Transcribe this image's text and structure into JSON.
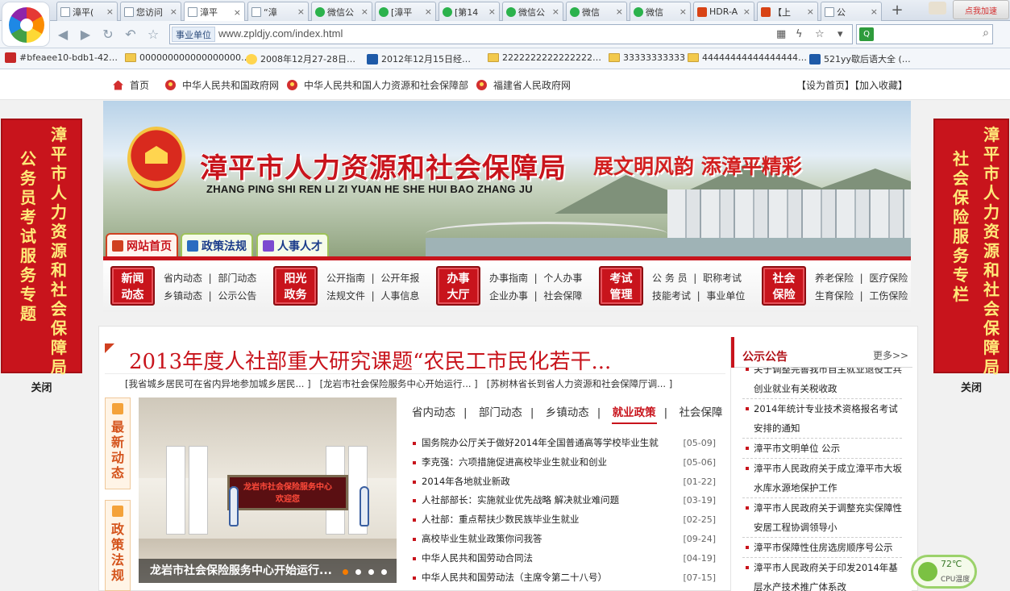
{
  "browser": {
    "tabs": [
      {
        "label": "漳平(",
        "icon": "page"
      },
      {
        "label": "您访问",
        "icon": "page"
      },
      {
        "label": "漳平",
        "icon": "page",
        "active": true
      },
      {
        "label": "“漳",
        "icon": "page"
      },
      {
        "label": "微信公",
        "icon": "wechat"
      },
      {
        "label": "[漳平",
        "icon": "wechat"
      },
      {
        "label": "[第14",
        "icon": "wechat"
      },
      {
        "label": "微信公",
        "icon": "wechat"
      },
      {
        "label": "微信",
        "icon": "wechat"
      },
      {
        "label": "微信",
        "icon": "wechat"
      },
      {
        "label": "HDR-A",
        "icon": "taobao"
      },
      {
        "label": "【上",
        "icon": "taobao"
      },
      {
        "label": "公",
        "icon": "page"
      }
    ],
    "new_tab": "+",
    "speedup_label": "点我加速",
    "site_tag": "事业单位",
    "url": "www.zpldjy.com/index.html",
    "bookmarks": [
      {
        "label": "#bfeaee10-bdb1-42…",
        "icon": "site-red"
      },
      {
        "label": "000000000000000000…",
        "icon": "folder"
      },
      {
        "label": "2008年12月27-28日…",
        "icon": "site-yellow"
      },
      {
        "label": "2012年12月15日经…",
        "icon": "site-blue"
      },
      {
        "label": "2222222222222222…",
        "icon": "folder"
      },
      {
        "label": "33333333333",
        "icon": "folder"
      },
      {
        "label": "44444444444444444…",
        "icon": "folder"
      },
      {
        "label": "521yy歇后语大全 (…",
        "icon": "site-blue"
      }
    ]
  },
  "site": {
    "topnav": {
      "home": "首页",
      "links": [
        "中华人民共和国政府网",
        "中华人民共和国人力资源和社会保障部",
        "福建省人民政府网"
      ],
      "set_home": "【设为首页】【加入收藏】"
    },
    "left_banner": {
      "line1": "漳平市人力资源和社会保障局",
      "line2": "公务员考试服务专题",
      "close": "关闭"
    },
    "right_banner": {
      "line1": "漳平市人力资源和社会保障局",
      "line2": "社会保险服务专栏",
      "close": "关闭"
    },
    "header": {
      "title": "漳平市人力资源和社会保障局",
      "pinyin": "ZHANG PING SHI REN LI ZI YUAN HE SHE HUI BAO ZHANG JU",
      "slogan": "展文明风韵  添漳平精彩",
      "tabs": [
        "网站首页",
        "政策法规",
        "人事人才"
      ]
    },
    "categories": [
      {
        "badge1": "新闻",
        "badge2": "动态",
        "links": [
          [
            "省内动态",
            "部门动态"
          ],
          [
            "乡镇动态",
            "公示公告"
          ]
        ]
      },
      {
        "badge1": "阳光",
        "badge2": "政务",
        "links": [
          [
            "公开指南",
            "公开年报"
          ],
          [
            "法规文件",
            "人事信息"
          ]
        ]
      },
      {
        "badge1": "办事",
        "badge2": "大厅",
        "links": [
          [
            "办事指南",
            "个人办事"
          ],
          [
            "企业办事",
            "社会保障"
          ]
        ]
      },
      {
        "badge1": "考试",
        "badge2": "管理",
        "links": [
          [
            "公 务 员",
            "职称考试"
          ],
          [
            "技能考试",
            "事业单位"
          ]
        ]
      },
      {
        "badge1": "社会",
        "badge2": "保险",
        "links": [
          [
            "养老保险",
            "医疗保险"
          ],
          [
            "生育保险",
            "工伤保险"
          ]
        ]
      }
    ],
    "headline": "2013年度人社部重大研究课题“农民工市民化若干...",
    "sublinks": [
      "[我省城乡居民可在省内异地参加城乡居民... ]",
      "[龙岩市社会保险服务中心开始运行... ]",
      "[苏树林省长到省人力资源和社会保障厅调... ]"
    ],
    "side_tabs": [
      "最新动态",
      "政策法规"
    ],
    "slider": {
      "sign_line1": "龙岩市社会保险服务中心",
      "sign_line2": "欢迎您",
      "caption": "龙岩市社会保险服务中心开始运行..."
    },
    "news_tabs": [
      "省内动态",
      "部门动态",
      "乡镇动态",
      "就业政策",
      "社会保障"
    ],
    "active_news_tab": "就业政策",
    "news": [
      {
        "title": "国务院办公厅关于做好2014年全国普通高等学校毕业生就",
        "date": "[05-09]"
      },
      {
        "title": "李克强：六项措施促进高校毕业生就业和创业",
        "date": "[05-06]"
      },
      {
        "title": "2014年各地就业新政",
        "date": "[01-22]"
      },
      {
        "title": "人社部部长：实施就业优先战略 解决就业难问题",
        "date": "[03-19]"
      },
      {
        "title": "人社部：重点帮扶少数民族毕业生就业",
        "date": "[02-25]"
      },
      {
        "title": "高校毕业生就业政策你问我答",
        "date": "[09-24]"
      },
      {
        "title": "中华人民共和国劳动合同法",
        "date": "[04-19]"
      },
      {
        "title": "中华人民共和国劳动法（主席令第二十八号）",
        "date": "[07-15]"
      }
    ],
    "notice": {
      "title": "公示公告",
      "more": "更多>>",
      "items": [
        "关于调整完善我市自主就业退役士兵创业就业有关税收政",
        "2014年统计专业技术资格报名考试安排的通知",
        "漳平市文明单位 公示",
        "漳平市人民政府关于成立漳平市大坂水库水源地保护工作",
        "漳平市人民政府关于调整充实保障性安居工程协调领导小",
        "漳平市保障性住房选房顺序号公示",
        "漳平市人民政府关于印发2014年基层水产技术推广体系改"
      ]
    }
  },
  "cpu_widget": {
    "temp": "72℃",
    "label": "CPU温度"
  }
}
